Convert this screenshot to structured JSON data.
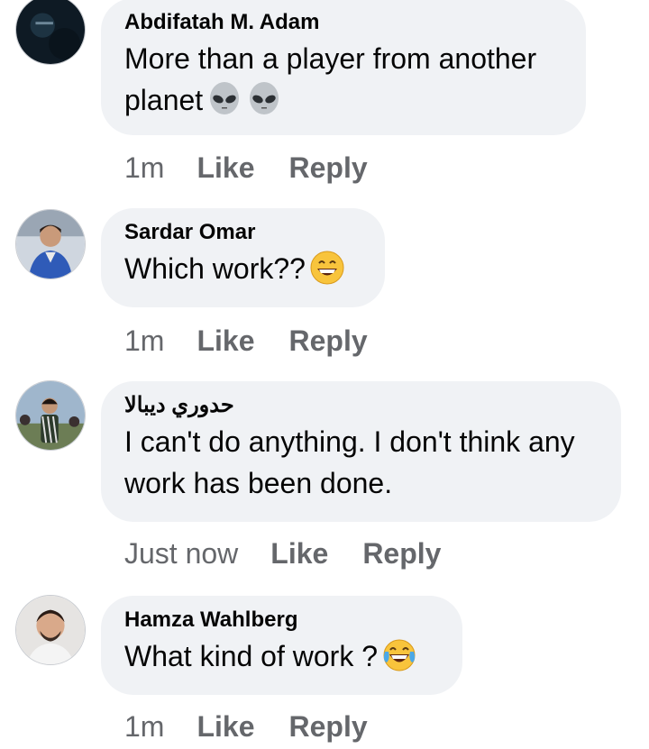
{
  "comments": [
    {
      "author": "Abdifatah M. Adam",
      "line1": "More than a player from another",
      "line2": "planet",
      "emojis": [
        "alien-emoji",
        "alien-emoji"
      ],
      "time": "1m",
      "like": "Like",
      "reply": "Reply"
    },
    {
      "author": "Sardar Omar",
      "line1": "Which work??",
      "emojis": [
        "grinning-sweat-emoji"
      ],
      "time": "1m",
      "like": "Like",
      "reply": "Reply"
    },
    {
      "author": "حدوري ديبالا",
      "line1": "I can't do anything. I don't think any",
      "line2": "work has been done.",
      "time": "Just now",
      "like": "Like",
      "reply": "Reply"
    },
    {
      "author": "Hamza Wahlberg",
      "line1": "What kind of work ?",
      "emojis": [
        "tears-of-joy-emoji"
      ],
      "time": "1m",
      "like": "Like",
      "reply": "Reply"
    }
  ],
  "colors": {
    "bubble": "#f0f2f5",
    "meta_text": "#65676b",
    "text": "#050505"
  }
}
